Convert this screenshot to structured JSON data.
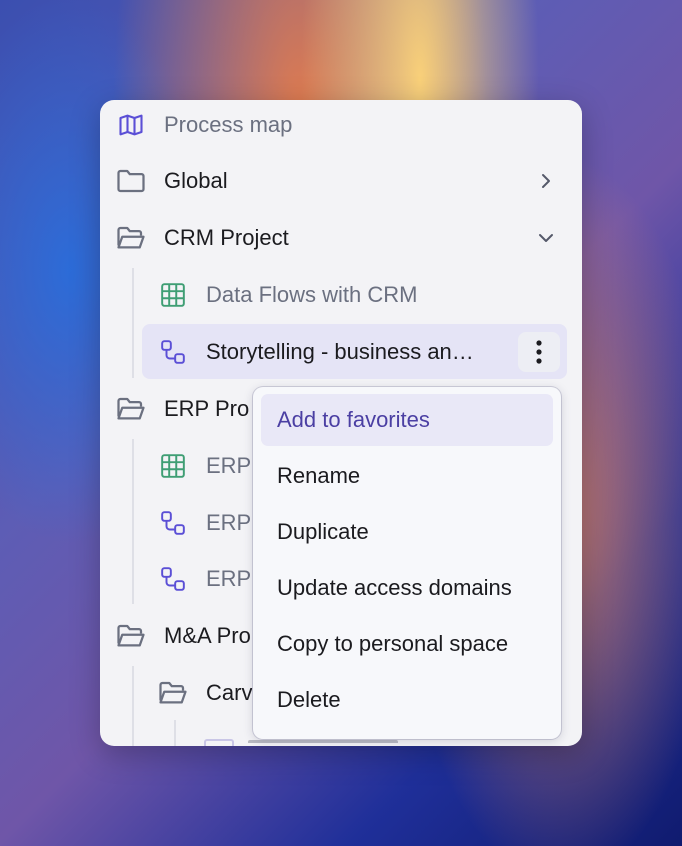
{
  "sidebar": {
    "items": [
      {
        "label": "Process map",
        "icon": "map-icon"
      },
      {
        "label": "Global",
        "icon": "folder-icon",
        "chevron": "chevron-right-icon"
      },
      {
        "label": "CRM Project",
        "icon": "folder-open-icon",
        "chevron": "chevron-down-icon"
      },
      {
        "label": "Data Flows with CRM",
        "icon": "table-icon"
      },
      {
        "label": "Storytelling - business an…",
        "icon": "process-flow-icon",
        "selected": true
      },
      {
        "label": "ERP Pro",
        "icon": "folder-open-icon"
      },
      {
        "label": "ERP",
        "icon": "table-icon"
      },
      {
        "label": "ERP",
        "icon": "process-flow-icon"
      },
      {
        "label": "ERP",
        "icon": "process-flow-icon"
      },
      {
        "label": "M&A Pro",
        "icon": "folder-open-icon"
      },
      {
        "label": "Carv",
        "icon": "folder-open-icon"
      }
    ]
  },
  "context_menu": {
    "items": [
      {
        "label": "Add to favorites",
        "highlighted": true
      },
      {
        "label": "Rename"
      },
      {
        "label": "Duplicate"
      },
      {
        "label": "Update access domains"
      },
      {
        "label": "Copy to personal space"
      },
      {
        "label": "Delete"
      }
    ]
  },
  "colors": {
    "accent": "#5b4fd6",
    "table_icon": "#3f9e74",
    "folder_icon": "#6b7080",
    "selected_bg": "#e5e4f6",
    "menu_highlight_bg": "#e9e8f7",
    "menu_highlight_text": "#4b3fa3"
  }
}
